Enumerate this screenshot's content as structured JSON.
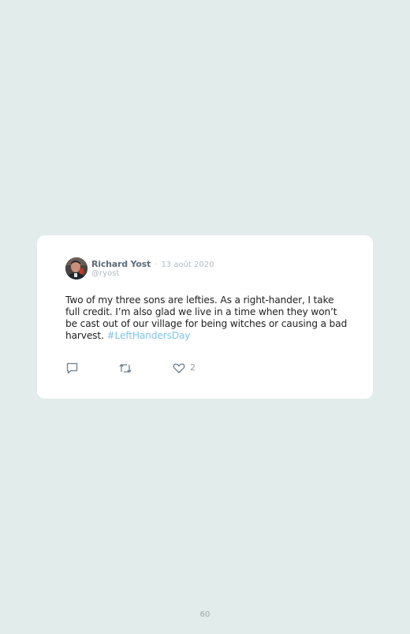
{
  "tweet": {
    "author_name": "Richard Yost",
    "separator": "·",
    "date": "13 août 2020",
    "handle": "@ryost",
    "text": "Two of my three sons are lefties. As a right-hander, I take full credit. I’m also glad we live in a time when they won’t be cast out of our village for being witches or causing a bad harvest. ",
    "hashtag": "#LeftHandersDay",
    "like_count": "2"
  },
  "icons": {
    "reply": "reply-icon",
    "retweet": "retweet-icon",
    "like": "heart-icon"
  },
  "colors": {
    "background": "#e2ecea",
    "card": "#ffffff",
    "hashtag": "#7ec6e6",
    "author": "#5d6e7c",
    "muted": "#b2bcc4"
  },
  "page": {
    "number": "60"
  }
}
